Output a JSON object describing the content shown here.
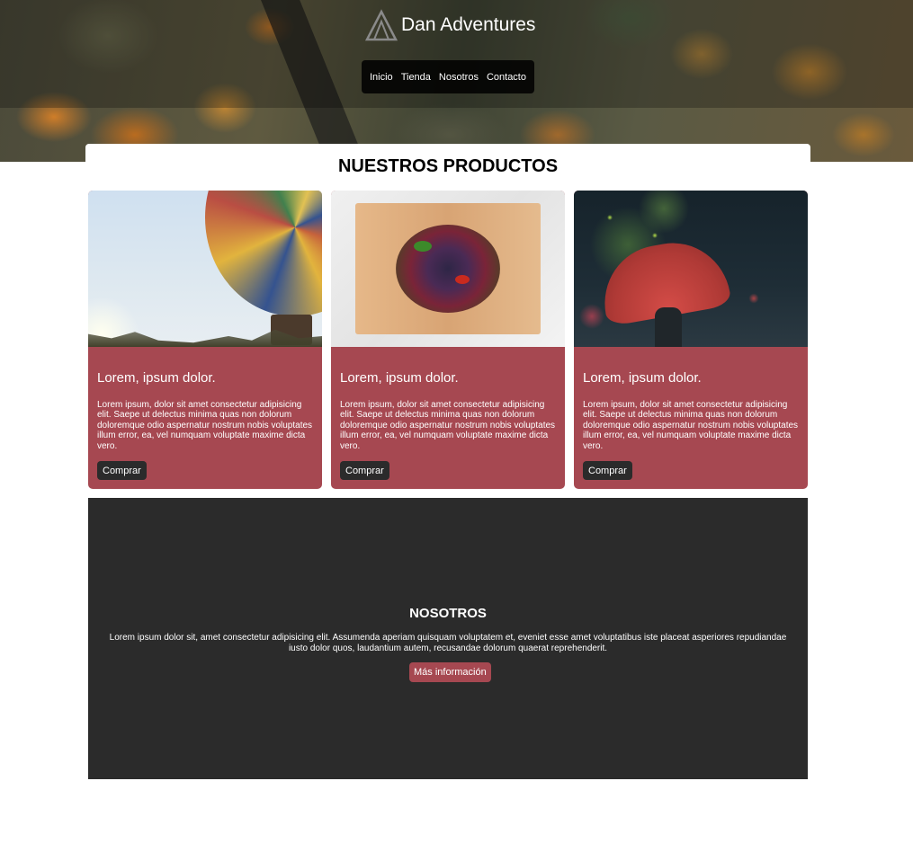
{
  "header": {
    "brand": "Dan Adventures",
    "logo_icon": "mountain-tent-icon",
    "nav": [
      {
        "label": "Inicio"
      },
      {
        "label": "Tienda"
      },
      {
        "label": "Nosotros"
      },
      {
        "label": "Contacto"
      }
    ]
  },
  "products": {
    "title": "NUESTROS PRODUCTOS",
    "cards": [
      {
        "image": "hot-air-balloon",
        "title": "Lorem, ipsum dolor.",
        "text": "Lorem ipsum, dolor sit amet consectetur adipisicing elit. Saepe ut delectus minima quas non dolorum doloremque odio aspernatur nostrum nobis voluptates illum error, ea, vel numquam voluptate maxime dicta vero.",
        "button": "Comprar"
      },
      {
        "image": "salad-bowl",
        "title": "Lorem, ipsum dolor.",
        "text": "Lorem ipsum, dolor sit amet consectetur adipisicing elit. Saepe ut delectus minima quas non dolorum doloremque odio aspernatur nostrum nobis voluptates illum error, ea, vel numquam voluptate maxime dicta vero.",
        "button": "Comprar"
      },
      {
        "image": "red-umbrella",
        "title": "Lorem, ipsum dolor.",
        "text": "Lorem ipsum, dolor sit amet consectetur adipisicing elit. Saepe ut delectus minima quas non dolorum doloremque odio aspernatur nostrum nobis voluptates illum error, ea, vel numquam voluptate maxime dicta vero.",
        "button": "Comprar"
      }
    ]
  },
  "about": {
    "title": "NOSOTROS",
    "text": "Lorem ipsum dolor sit, amet consectetur adipisicing elit. Assumenda aperiam quisquam voluptatem et, eveniet esse amet voluptatibus iste placeat asperiores repudiandae iusto dolor quos, laudantium autem, recusandae dolorum quaerat reprehenderit.",
    "button": "Más información"
  },
  "colors": {
    "accent": "#a64851",
    "dark": "#2b2b2b"
  }
}
